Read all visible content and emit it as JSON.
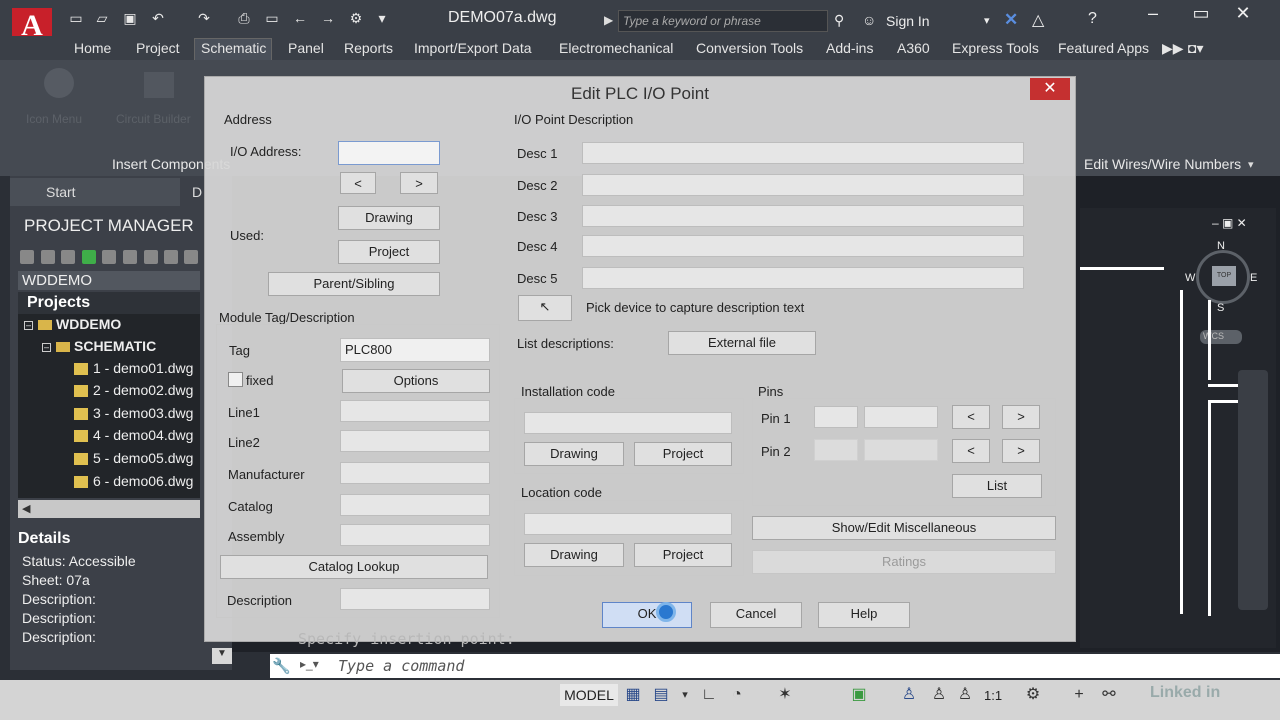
{
  "app": {
    "logo_letter": "A",
    "doc_title": "DEMO07a.dwg",
    "search_placeholder": "Type a keyword or phrase",
    "signin": "Sign In"
  },
  "menu": [
    "Home",
    "Project",
    "Schematic",
    "Panel",
    "Reports",
    "Import/Export Data",
    "Electromechanical",
    "Conversion Tools",
    "Add-ins",
    "A360",
    "Express Tools",
    "Featured Apps"
  ],
  "ribbon": {
    "icon_menu": "Icon Menu",
    "circuit_builder": "Circuit Builder",
    "insert_components": "Insert Components",
    "edit_wires": "Edit Wires/Wire Numbers"
  },
  "tabs": {
    "start": "Start",
    "drawing_fragment": "D"
  },
  "project_manager": {
    "title": "PROJECT MANAGER",
    "project_name": "WDDEMO",
    "projects_header": "Projects",
    "tree_root": "WDDEMO",
    "tree_folder": "SCHEMATIC",
    "drawings": [
      "1 - demo01.dwg",
      "2 - demo02.dwg",
      "3 - demo03.dwg",
      "4 - demo04.dwg",
      "5 - demo05.dwg",
      "6 - demo06.dwg"
    ]
  },
  "details": {
    "header": "Details",
    "status": "Status: Accessible",
    "sheet": "Sheet: 07a",
    "description": "Description:"
  },
  "viewcube": {
    "n": "N",
    "s": "S",
    "e": "E",
    "w": "W",
    "top": "TOP",
    "wcs": "WCS"
  },
  "command": {
    "placeholder": "Type a command",
    "ghost": "Specify insertion point:"
  },
  "status_bar": {
    "model": "MODEL",
    "scale": "1:1",
    "watermark": "Linked in"
  },
  "dialog": {
    "title": "Edit PLC I/O Point",
    "address_group": "Address",
    "io_address_label": "I/O Address:",
    "io_address_value": "",
    "prev": "<",
    "next": ">",
    "used_label": "Used:",
    "drawing": "Drawing",
    "project": "Project",
    "parent_sibling": "Parent/Sibling",
    "module_group": "Module Tag/Description",
    "tag_label": "Tag",
    "tag_value": "PLC800",
    "fixed_label": "fixed",
    "options": "Options",
    "line1": "Line1",
    "line2": "Line2",
    "manufacturer": "Manufacturer",
    "catalog": "Catalog",
    "assembly": "Assembly",
    "catalog_lookup": "Catalog Lookup",
    "description": "Description",
    "io_desc_group": "I/O Point Description",
    "desc_labels": [
      "Desc 1",
      "Desc 2",
      "Desc 3",
      "Desc 4",
      "Desc 5"
    ],
    "pick_device": "Pick device to capture description text",
    "list_descriptions": "List descriptions:",
    "external_file": "External file",
    "installation_code": "Installation code",
    "location_code": "Location code",
    "pins_group": "Pins",
    "pin1": "Pin 1",
    "pin2": "Pin 2",
    "list": "List",
    "show_edit_misc": "Show/Edit Miscellaneous",
    "ratings": "Ratings",
    "ok": "OK",
    "cancel": "Cancel",
    "help": "Help"
  }
}
